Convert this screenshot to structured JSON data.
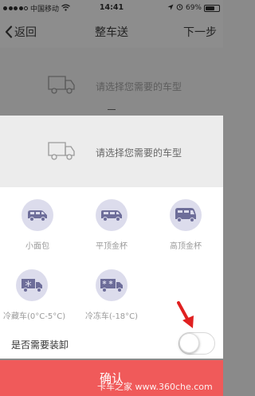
{
  "status_bar": {
    "carrier": "中国移动",
    "time": "14:41",
    "battery": "69%",
    "battery_level": 0.69,
    "signal_bars": 4
  },
  "nav": {
    "back_label": "返回",
    "title": "整车送",
    "next_label": "下一步"
  },
  "background": {
    "prompt": "请选择您需要的车型"
  },
  "sheet": {
    "prompt": "请选择您需要的车型",
    "vehicles": [
      {
        "label": "小面包",
        "icon": "minivan-icon"
      },
      {
        "label": "平顶金杯",
        "icon": "flat-roof-van-icon"
      },
      {
        "label": "高顶金杯",
        "icon": "high-roof-van-icon"
      },
      {
        "label": "冷藏车(0°C-5°C)",
        "icon": "refrigerated-truck-icon"
      },
      {
        "label": "冷冻车(-18°C)",
        "icon": "freezer-truck-icon"
      }
    ],
    "unload_label": "是否需要装卸",
    "unload_enabled": false
  },
  "confirm_label": "确认",
  "watermark": "卡车之家 www.360che.com",
  "colors": {
    "accent": "#f05a5a",
    "icon_bg": "#dcdcec",
    "icon_fg": "#6d6d99"
  }
}
